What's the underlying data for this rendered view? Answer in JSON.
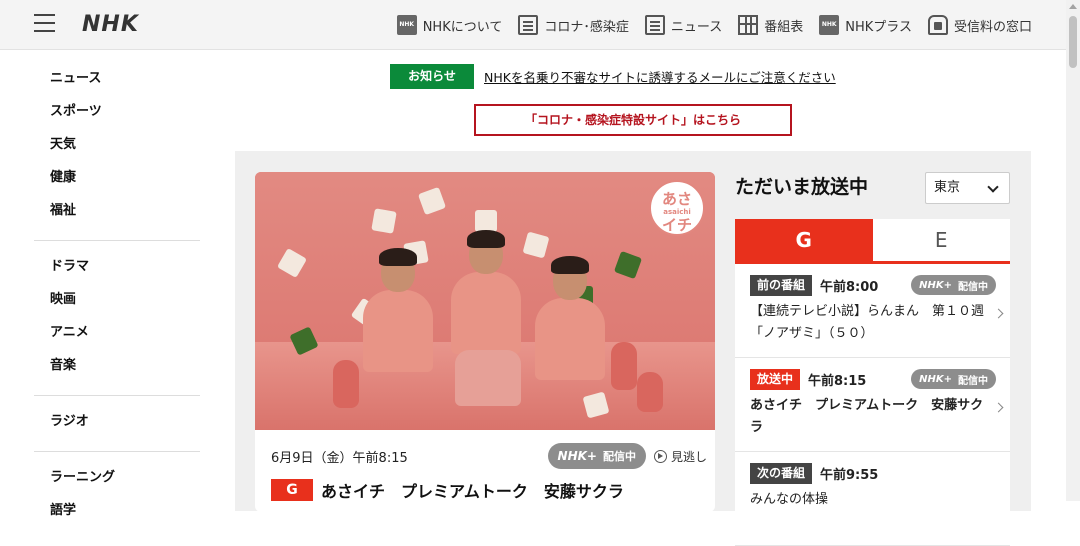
{
  "header": {
    "logo": "NHK",
    "nav": [
      {
        "label": "NHKについて",
        "icon": "nhk-icon",
        "glyph": "NHK"
      },
      {
        "label": "コロナ･感染症",
        "icon": "virus-info-icon",
        "glyph": ""
      },
      {
        "label": "ニュース",
        "icon": "newspaper-icon",
        "glyph": ""
      },
      {
        "label": "番組表",
        "icon": "program-guide-icon",
        "glyph": ""
      },
      {
        "label": "NHKプラス",
        "icon": "nhk-plus-icon",
        "glyph": "NHK"
      },
      {
        "label": "受信料の窓口",
        "icon": "reception-fee-icon",
        "glyph": ""
      }
    ]
  },
  "sidebar": {
    "groups": [
      [
        "ニュース",
        "スポーツ",
        "天気",
        "健康",
        "福祉"
      ],
      [
        "ドラマ",
        "映画",
        "アニメ",
        "音楽"
      ],
      [
        "ラジオ"
      ],
      [
        "ラーニング",
        "語学"
      ]
    ]
  },
  "notice": {
    "tag": "お知らせ",
    "text": "NHKを名乗り不審なサイトに誘導するメールにご注意ください"
  },
  "corona_link": "「コロナ・感染症特設サイト」はこちら",
  "feature": {
    "badge_top": "あさ",
    "badge_sub": "asaichi",
    "badge_bottom": "イチ",
    "date": "6月9日（金）午前8:15",
    "stream_logo": "NHK+",
    "stream_label": "配信中",
    "missed": "見逃し",
    "channel": "G",
    "title": "あさイチ　プレミアムトーク　安藤サクラ"
  },
  "onair": {
    "title": "ただいま放送中",
    "region": "東京",
    "tabs": [
      "G",
      "E"
    ],
    "active_tab": "G",
    "rows": [
      {
        "label": "前の番組",
        "time": "午前8:00",
        "pill_logo": "NHK+",
        "pill": "配信中",
        "title": "【連続テレビ小説】らんまん　第１０週「ノアザミ」（５０）",
        "live": false
      },
      {
        "label": "放送中",
        "time": "午前8:15",
        "pill_logo": "NHK+",
        "pill": "配信中",
        "title": "あさイチ　プレミアムトーク　安藤サクラ",
        "live": true
      },
      {
        "label": "次の番組",
        "time": "午前9:55",
        "pill_logo": "",
        "pill": "",
        "title": "みんなの体操",
        "live": false
      }
    ]
  },
  "colors": {
    "accent": "#e8301c",
    "notice": "#0b8a3a",
    "corona": "#b5141f"
  }
}
